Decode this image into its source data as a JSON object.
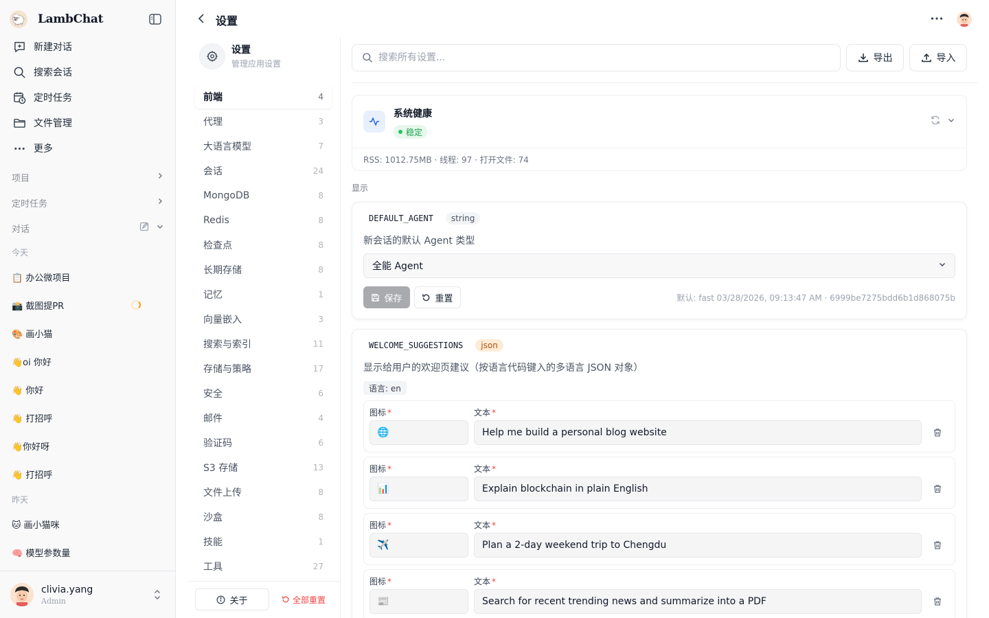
{
  "app": {
    "name": "LambChat",
    "logo_glyph": "🐑"
  },
  "sidebar": {
    "nav": [
      {
        "label": "新建对话",
        "icon": "new-chat-icon"
      },
      {
        "label": "搜索会话",
        "icon": "search-icon"
      },
      {
        "label": "定时任务",
        "icon": "calendar-clock-icon"
      },
      {
        "label": "文件管理",
        "icon": "folder-icon"
      },
      {
        "label": "更多",
        "icon": "more-dots-icon"
      }
    ],
    "sections": {
      "projects": "项目",
      "scheduled": "定时任务",
      "chats": "对话"
    },
    "groups": [
      {
        "label": "今天",
        "items": [
          "📋 办公微项目",
          "📸 截图提PR",
          "🎨 画小猫",
          "👋oi 你好",
          "👋 你好",
          "👋 打招呼",
          "👋你好呀",
          "👋 打招呼"
        ]
      },
      {
        "label": "昨天",
        "items": [
          "🐱 画小猫咪",
          "🧠 模型参数量"
        ]
      }
    ],
    "user": {
      "name": "clivia.yang",
      "role": "Admin"
    }
  },
  "header": {
    "title": "设置"
  },
  "settings_nav": {
    "title": "设置",
    "subtitle": "管理应用设置",
    "categories": [
      {
        "label": "前端",
        "count": "4",
        "active": true
      },
      {
        "label": "代理",
        "count": "3"
      },
      {
        "label": "大语言模型",
        "count": "7"
      },
      {
        "label": "会话",
        "count": "24"
      },
      {
        "label": "MongoDB",
        "count": "8"
      },
      {
        "label": "Redis",
        "count": "8"
      },
      {
        "label": "检查点",
        "count": "8"
      },
      {
        "label": "长期存储",
        "count": "8"
      },
      {
        "label": "记忆",
        "count": "1"
      },
      {
        "label": "向量嵌入",
        "count": "3"
      },
      {
        "label": "搜索与索引",
        "count": "11"
      },
      {
        "label": "存储与策略",
        "count": "17"
      },
      {
        "label": "安全",
        "count": "6"
      },
      {
        "label": "邮件",
        "count": "4"
      },
      {
        "label": "验证码",
        "count": "6"
      },
      {
        "label": "S3 存储",
        "count": "13"
      },
      {
        "label": "文件上传",
        "count": "8"
      },
      {
        "label": "沙盒",
        "count": "8"
      },
      {
        "label": "技能",
        "count": "1"
      },
      {
        "label": "工具",
        "count": "27"
      }
    ],
    "about_label": "关于",
    "reset_all_label": "全部重置"
  },
  "toolbar": {
    "search_placeholder": "搜索所有设置...",
    "export_label": "导出",
    "import_label": "导入"
  },
  "health": {
    "title": "系统健康",
    "status": "稳定",
    "stats": "RSS: 1012.75MB · 线程: 97 · 打开文件: 74",
    "status_color": "#16a34a"
  },
  "section": {
    "label": "显示"
  },
  "default_agent": {
    "key": "DEFAULT_AGENT",
    "type": "string",
    "description": "新会话的默认 Agent 类型",
    "value": "全能 Agent",
    "save_label": "保存",
    "reset_label": "重置",
    "meta": "默认: fast  03/28/2026, 09:13:47 AM · 6999be7275bdd6b1d868075b"
  },
  "welcome": {
    "key": "WELCOME_SUGGESTIONS",
    "type": "json",
    "description": "显示给用户的欢迎页建议（按语言代码键入的多语言 JSON 对象）",
    "lang_tag": "语言: en",
    "icon_label": "图标",
    "text_label": "文本",
    "required_mark": "*",
    "items": [
      {
        "icon": "🌐",
        "text": "Help me build a personal blog website"
      },
      {
        "icon": "📊",
        "text": "Explain blockchain in plain English"
      },
      {
        "icon": "✈️",
        "text": "Plan a 2-day weekend trip to Chengdu"
      },
      {
        "icon": "📰",
        "text": "Search for recent trending news and summarize into a PDF"
      }
    ]
  }
}
